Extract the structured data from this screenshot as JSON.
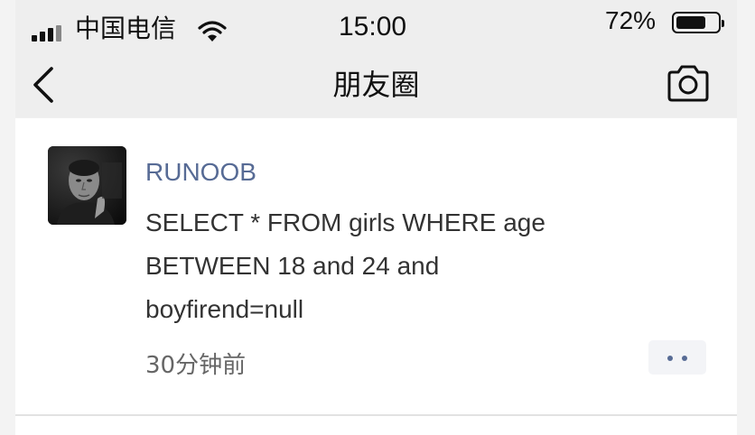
{
  "status_bar": {
    "carrier": "中国电信",
    "time": "15:00",
    "battery_percent": "72%",
    "battery_level": 0.72,
    "signal_icon": "signal-bars-icon",
    "wifi_icon": "wifi-icon",
    "battery_icon": "battery-icon"
  },
  "nav_bar": {
    "title": "朋友圈",
    "back_icon": "chevron-left-icon",
    "camera_icon": "camera-icon"
  },
  "colors": {
    "author_link": "#576b95",
    "more_dots": "#576b95",
    "nav_background": "#eeeeee",
    "feed_background": "#ffffff"
  },
  "posts": [
    {
      "author": "RUNOOB",
      "text_lines": [
        "SELECT * FROM girls WHERE age",
        "BETWEEN 18 and 24 and",
        "boyfirend=null"
      ],
      "time": "30分钟前",
      "more_icon": "more-dots-icon"
    }
  ]
}
